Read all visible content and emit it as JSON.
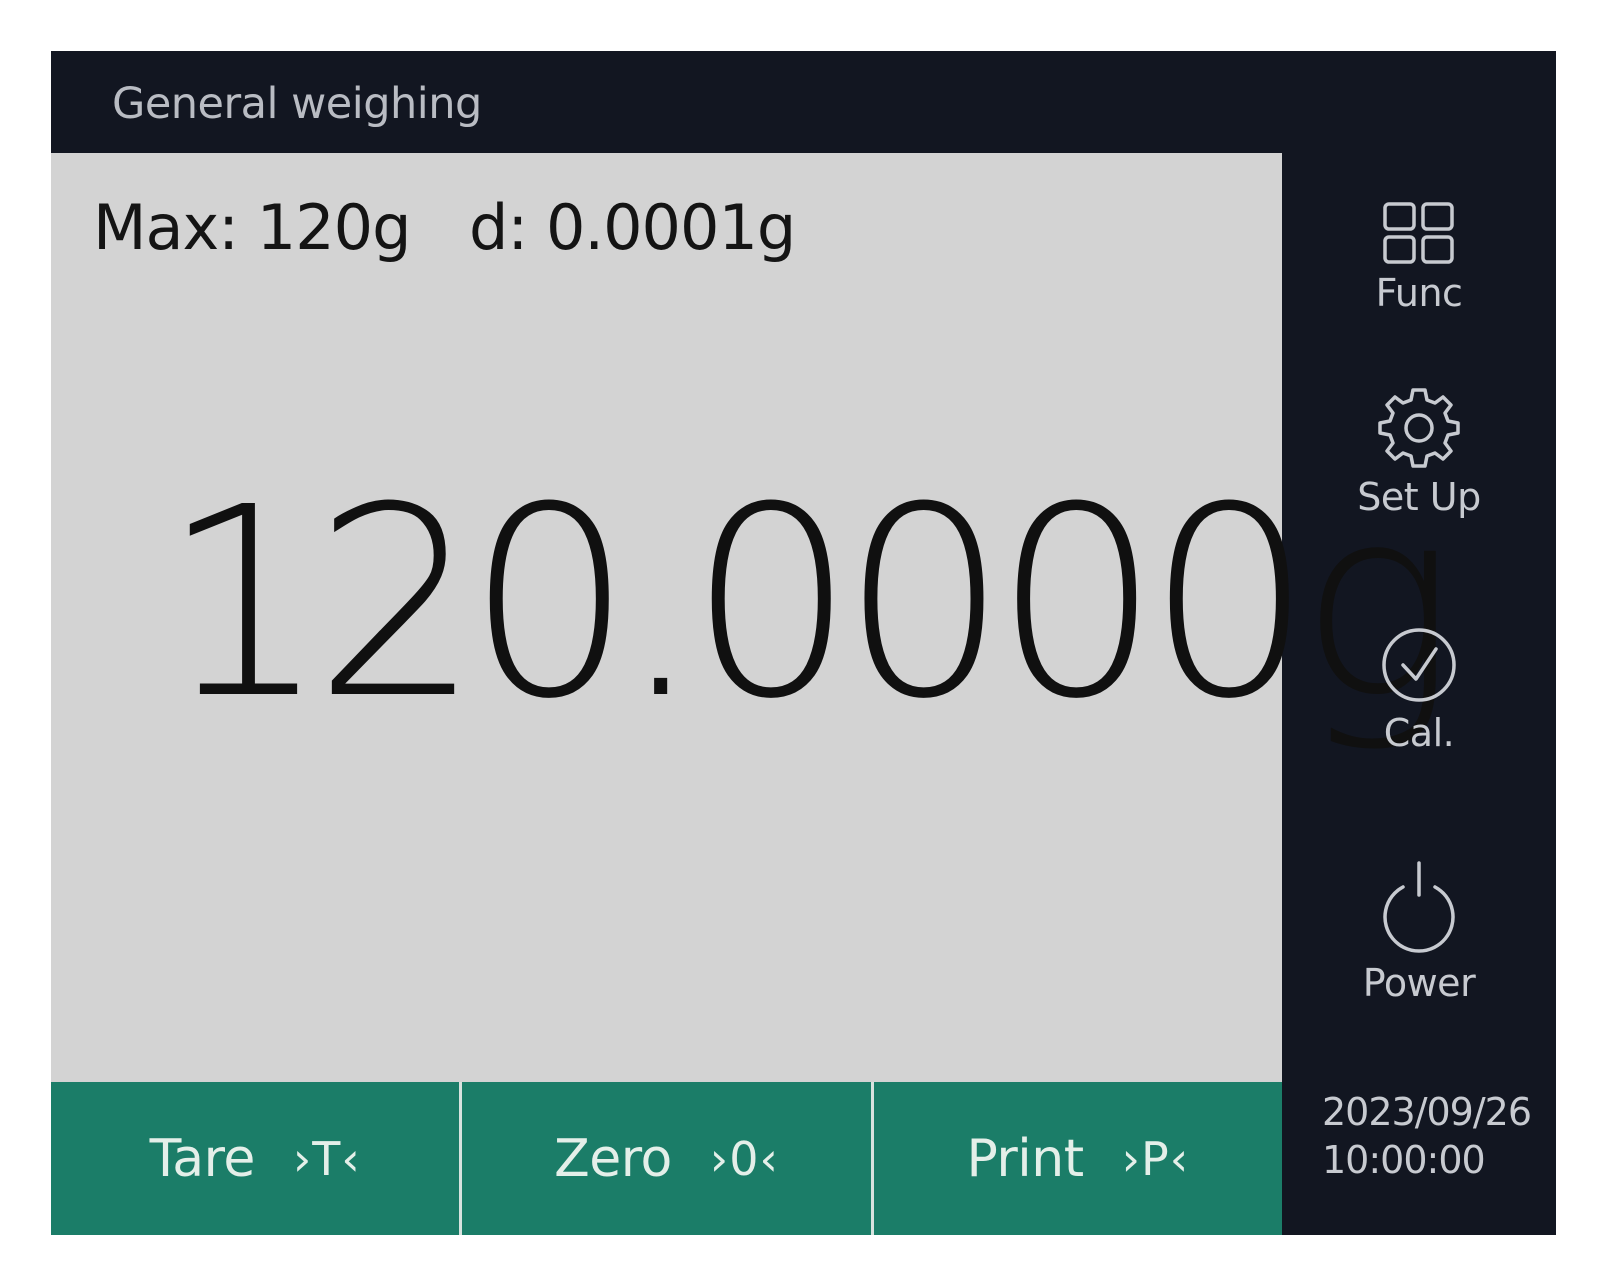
{
  "header": {
    "title": "General weighing"
  },
  "display": {
    "max_capacity": "Max: 120g",
    "readability": "d: 0.0001g",
    "weight_reading": "120.0000g"
  },
  "bottom_keys": [
    {
      "label": "Tare",
      "symbol": "›T‹"
    },
    {
      "label": "Zero",
      "symbol": "›0‹"
    },
    {
      "label": "Print",
      "symbol": "›P‹"
    }
  ],
  "sidebar": {
    "items": [
      {
        "label": "Func",
        "icon": "grid-icon"
      },
      {
        "label": "Set Up",
        "icon": "gear-icon"
      },
      {
        "label": "Cal.",
        "icon": "check-circle-icon"
      },
      {
        "label": "Power",
        "icon": "power-icon"
      }
    ],
    "date": "2023/09/26",
    "time": "10:00:00"
  },
  "colors": {
    "frame": "#121621",
    "display_background": "#d3d3d3",
    "key_accent": "#1b7d68",
    "sidebar_text": "#c7cad0"
  }
}
